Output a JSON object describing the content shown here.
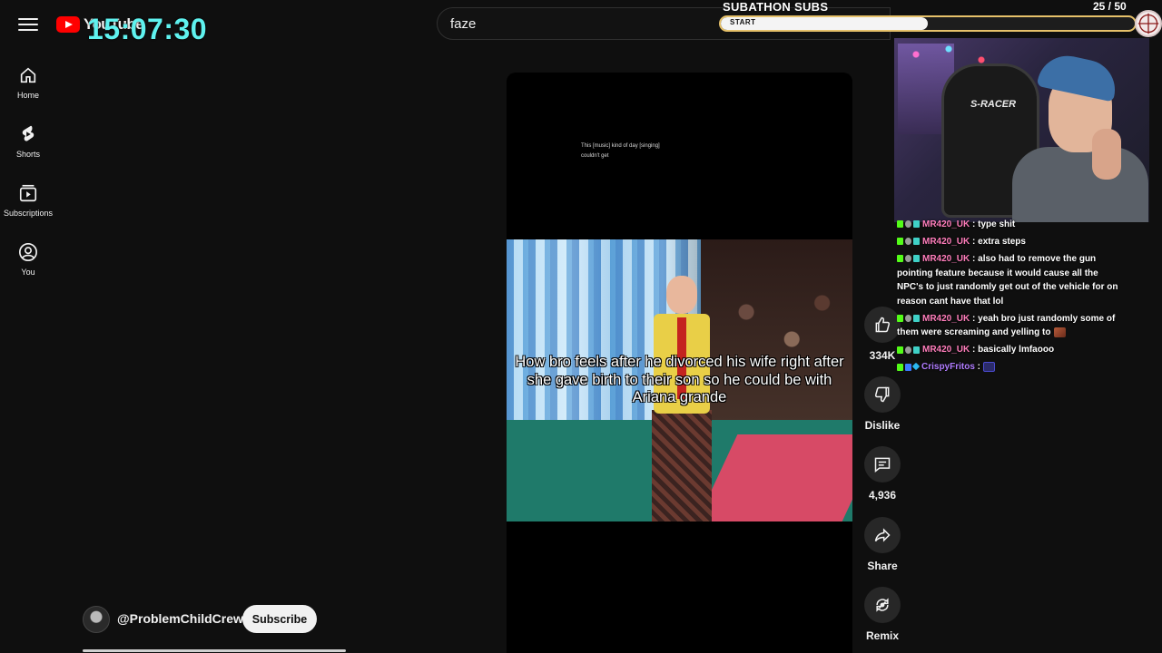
{
  "header": {
    "logo_text": "YouTube",
    "search_query": "faze"
  },
  "overlay": {
    "clock": "15:07:30",
    "subathon": {
      "title": "SUBATHON SUBS",
      "start_label": "START",
      "count": "25 / 50",
      "progress": 0.5,
      "accent": "#e6c16a"
    }
  },
  "nav": {
    "items": [
      {
        "label": "Home",
        "icon": "home-icon"
      },
      {
        "label": "Shorts",
        "icon": "shorts-icon"
      },
      {
        "label": "Subscriptions",
        "icon": "subscriptions-icon"
      },
      {
        "label": "You",
        "icon": "you-icon"
      }
    ]
  },
  "video": {
    "captions_line1": "This [music] kind of day [singing]",
    "captions_line2": "couldn't get",
    "caption_overlay": "How bro feels after he divorced his wife right after she gave birth to their son so he could be with Ariana grande"
  },
  "actions": {
    "like_count": "334K",
    "dislike_label": "Dislike",
    "comment_count": "4,936",
    "share_label": "Share",
    "remix_label": "Remix"
  },
  "channel": {
    "handle": "@ProblemChildCrew",
    "subscribe_label": "Subscribe"
  },
  "webcam": {
    "chair_brand": "S-RACER"
  },
  "chat": {
    "messages": [
      {
        "user": "MR420_UK",
        "text": ": type shit",
        "color": "#ff7dbb"
      },
      {
        "user": "MR420_UK",
        "text": ": extra steps",
        "color": "#ff7dbb"
      },
      {
        "user": "MR420_UK",
        "text": ": also had to remove the gun pointing feature because it would cause all the NPC's to just randomly get out of the vehicle for on reason cant have that lol",
        "color": "#ff7dbb"
      },
      {
        "user": "MR420_UK",
        "text": ": yeah bro just randomly some of them were screaming and yelling to",
        "color": "#ff7dbb",
        "emote": "face"
      },
      {
        "user": "MR420_UK",
        "text": ": basically lmfaooo",
        "color": "#ff7dbb"
      },
      {
        "user": "CrispyFritos",
        "text": ":",
        "color": "#b07cff",
        "emote": "dark"
      }
    ]
  },
  "colors": {
    "background": "#0f0f0f",
    "clock": "#5ff2ef",
    "youtube_red": "#ff0000"
  }
}
